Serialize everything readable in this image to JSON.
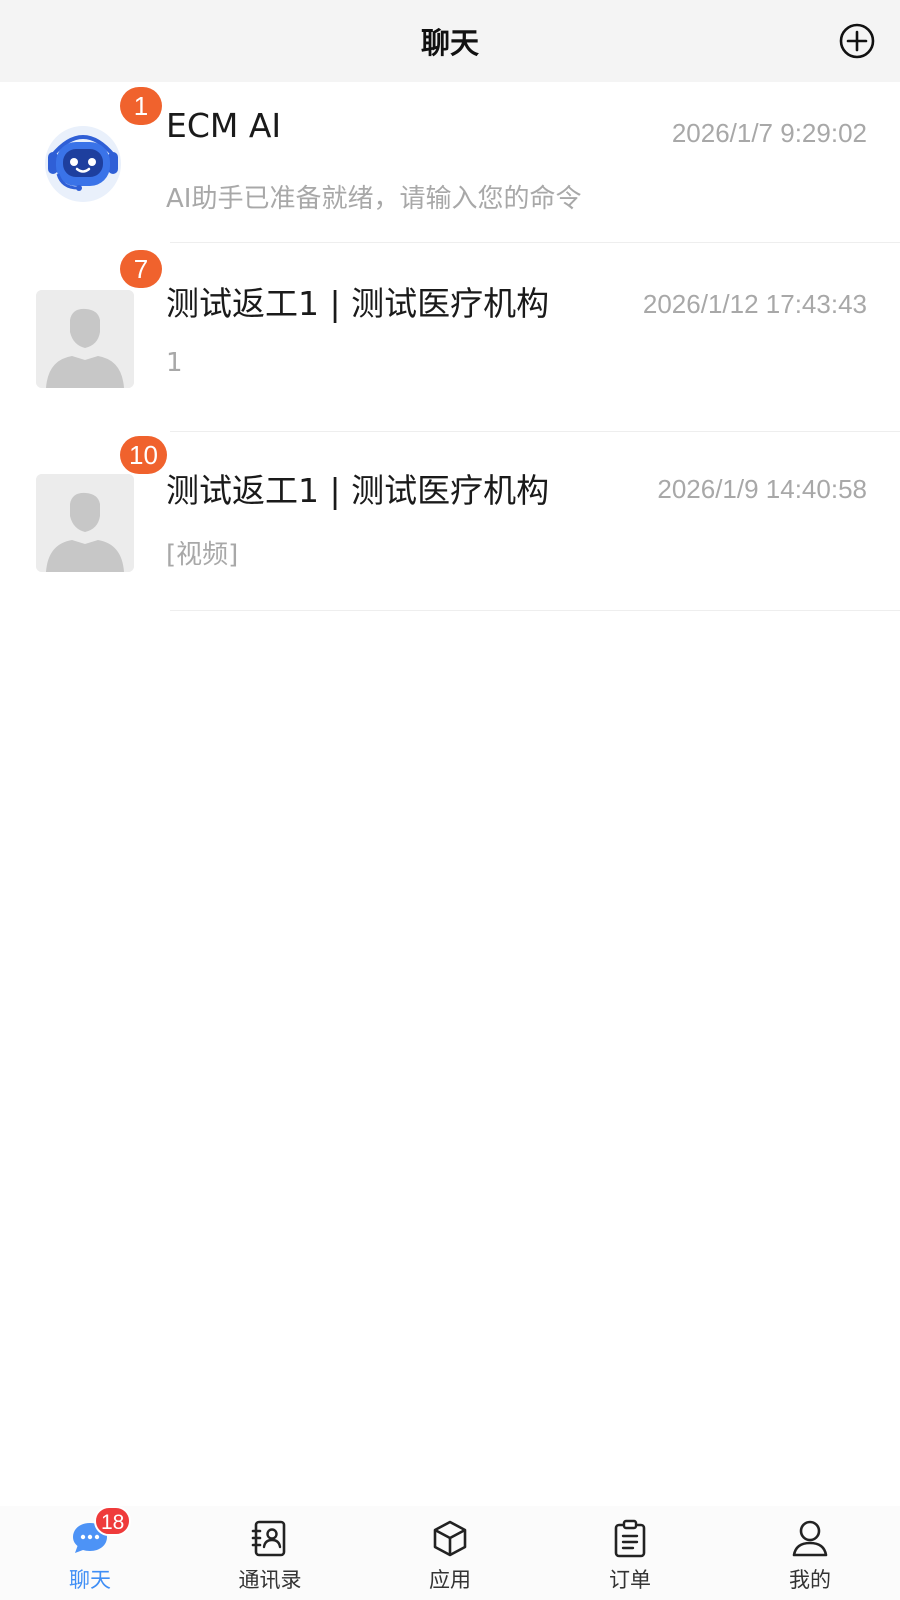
{
  "header": {
    "title": "聊天"
  },
  "chats": [
    {
      "name": "ECM AI",
      "time": "2026/1/7 9:29:02",
      "preview": "AI助手已准备就绪，请输入您的命令",
      "badge": "1"
    },
    {
      "name": "测试返工1 | 测试医疗机构",
      "time": "2026/1/12 17:43:43",
      "preview": "1",
      "badge": "7"
    },
    {
      "name": "测试返工1 | 测试医疗机构",
      "time": "2026/1/9 14:40:58",
      "preview": "[视频]",
      "badge": "10"
    }
  ],
  "tabs": [
    {
      "label": "聊天",
      "icon": "chat-bubble-icon",
      "badge": "18",
      "active": true
    },
    {
      "label": "通讯录",
      "icon": "contacts-icon"
    },
    {
      "label": "应用",
      "icon": "cube-icon"
    },
    {
      "label": "订单",
      "icon": "clipboard-icon"
    },
    {
      "label": "我的",
      "icon": "person-icon"
    }
  ],
  "colors": {
    "badge": "#f0622d",
    "tab_badge": "#ef3b3b",
    "accent": "#3f8ef5",
    "muted_text": "#a8a8a8"
  }
}
